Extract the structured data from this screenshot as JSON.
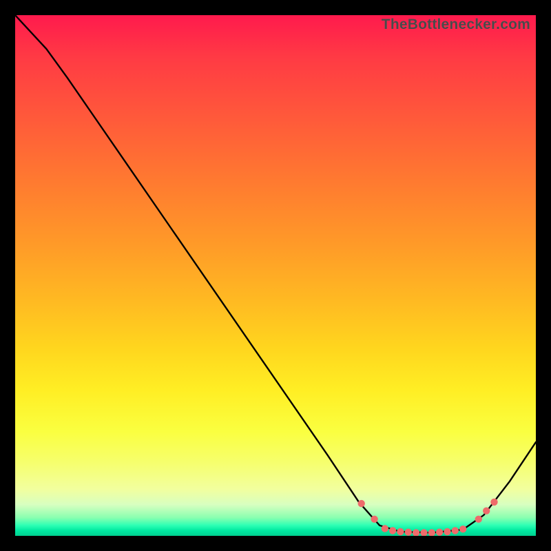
{
  "watermark": {
    "text": "TheBottlenecker.com"
  },
  "chart_data": {
    "type": "line",
    "title": "",
    "xlabel": "",
    "ylabel": "",
    "xlim": [
      0,
      100
    ],
    "ylim": [
      0,
      100
    ],
    "curve": {
      "name": "bottleneck-curve",
      "comment": "x in 0..100, y in 0..100 (0=bottom, 100=top). Approximate shape read from pixels; no numeric labels present.",
      "points": [
        {
          "x": 0,
          "y": 100
        },
        {
          "x": 6,
          "y": 93.5
        },
        {
          "x": 10,
          "y": 88
        },
        {
          "x": 20,
          "y": 73.5
        },
        {
          "x": 30,
          "y": 59
        },
        {
          "x": 40,
          "y": 44.5
        },
        {
          "x": 50,
          "y": 30
        },
        {
          "x": 60,
          "y": 15.5
        },
        {
          "x": 66,
          "y": 6.5
        },
        {
          "x": 70,
          "y": 2
        },
        {
          "x": 74,
          "y": 0.8
        },
        {
          "x": 80,
          "y": 0.6
        },
        {
          "x": 86,
          "y": 1.2
        },
        {
          "x": 90,
          "y": 4
        },
        {
          "x": 95,
          "y": 10.5
        },
        {
          "x": 100,
          "y": 18
        }
      ]
    },
    "markers": {
      "name": "optimum-band-markers",
      "color": "#ee6b6b",
      "points": [
        {
          "x": 66.5,
          "y": 6.2
        },
        {
          "x": 69,
          "y": 3.2
        },
        {
          "x": 71,
          "y": 1.4
        },
        {
          "x": 72.5,
          "y": 1.0
        },
        {
          "x": 74,
          "y": 0.8
        },
        {
          "x": 75.5,
          "y": 0.7
        },
        {
          "x": 77,
          "y": 0.6
        },
        {
          "x": 78.5,
          "y": 0.6
        },
        {
          "x": 80,
          "y": 0.6
        },
        {
          "x": 81.5,
          "y": 0.7
        },
        {
          "x": 83,
          "y": 0.8
        },
        {
          "x": 84.5,
          "y": 1.0
        },
        {
          "x": 86,
          "y": 1.3
        },
        {
          "x": 89,
          "y": 3.2
        },
        {
          "x": 90.5,
          "y": 4.8
        },
        {
          "x": 92,
          "y": 6.5
        }
      ]
    }
  }
}
